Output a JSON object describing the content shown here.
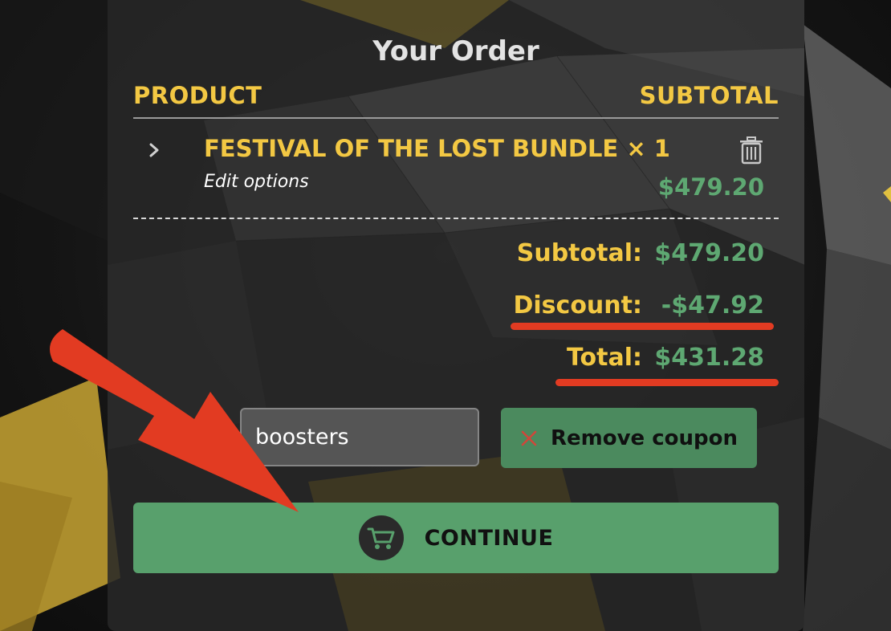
{
  "order": {
    "title": "Your Order",
    "col_product": "PRODUCT",
    "col_subtotal": "SUBTOTAL",
    "item": {
      "name": "FESTIVAL OF THE LOST BUNDLE × 1",
      "edit_label": "Edit options",
      "price": "$479.20"
    },
    "summary": {
      "subtotal_label": "Subtotal:",
      "subtotal_value": "$479.20",
      "discount_label": "Discount:",
      "discount_value": "-$47.92",
      "total_label": "Total:",
      "total_value": "$431.28"
    }
  },
  "coupon": {
    "value": "boosters",
    "remove_label": "Remove coupon"
  },
  "continue_label": "CONTINUE",
  "icons": {
    "expand": "chevron-right-icon",
    "delete": "trash-icon",
    "remove": "close-icon",
    "checkout": "shopping-cart-icon"
  },
  "colors": {
    "accent_yellow": "#f3c843",
    "price_green": "#5ea872",
    "button_green": "#58a06c",
    "remove_button_green": "#4b8a5e",
    "annotation_red": "#e23b22"
  }
}
